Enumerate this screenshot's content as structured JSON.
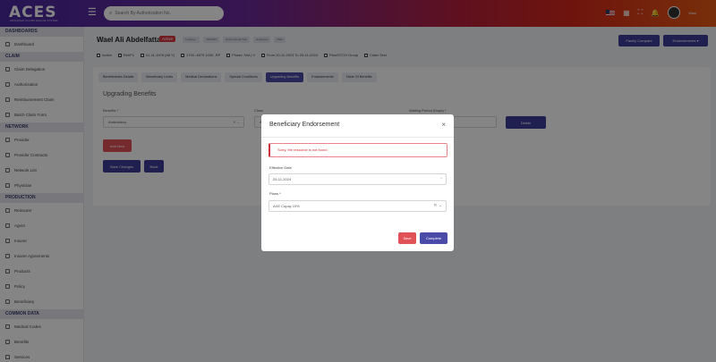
{
  "app": {
    "logo_text": "ACES",
    "logo_subtitle": "ADVANCED CLAIMS ENGINE SYSTEM"
  },
  "topbar": {
    "search_placeholder": "Search By Authorization No.",
    "user_label": "Waw"
  },
  "sidebar": {
    "sections": [
      {
        "title": "DASHBOARDS",
        "items": [
          {
            "label": "Dashboard",
            "icon": "grid-icon"
          }
        ]
      },
      {
        "title": "CLAIM",
        "items": [
          {
            "label": "Claim Delegation",
            "icon": "doc-icon"
          },
          {
            "label": "Authorization",
            "icon": "heart-icon"
          },
          {
            "label": "Reimbursement Claim",
            "icon": "receipt-icon"
          },
          {
            "label": "Batch Claim Form",
            "icon": "list-icon"
          }
        ]
      },
      {
        "title": "NETWORK",
        "items": [
          {
            "label": "Provider",
            "icon": "building-icon"
          },
          {
            "label": "Provider Contracts",
            "icon": "contract-icon"
          },
          {
            "label": "Network List",
            "icon": "network-icon"
          },
          {
            "label": "Physician",
            "icon": "user-md-icon"
          }
        ]
      },
      {
        "title": "PRODUCTION",
        "items": [
          {
            "label": "Reinsurer",
            "icon": "shield-icon"
          },
          {
            "label": "Agent",
            "icon": "user-icon"
          },
          {
            "label": "Insurer",
            "icon": "briefcase-icon"
          },
          {
            "label": "Insurer Agreements",
            "icon": "handshake-icon"
          },
          {
            "label": "Products",
            "icon": "box-icon"
          },
          {
            "label": "Policy",
            "icon": "policy-icon"
          },
          {
            "label": "Beneficiary",
            "icon": "people-icon"
          }
        ]
      },
      {
        "title": "COMMON DATA",
        "items": [
          {
            "label": "Medical Codes",
            "icon": "star-icon"
          },
          {
            "label": "Benefits",
            "icon": "gear-icon"
          },
          {
            "label": "Services",
            "icon": "service-icon"
          }
        ]
      }
    ]
  },
  "header": {
    "name": "Wael Ali Abdelfattah",
    "status": "Active",
    "tags": [
      "Loading...",
      "2150403",
      "Fixed Annual Plan",
      "Employee",
      "Male"
    ],
    "info": [
      "Active",
      "Rel/P1",
      "01-11-1976 (48 Y)",
      "1700 -4679 1030 -RP",
      "Phase: N/A | 0",
      "From 20-11-2023 To 25-11-2024",
      "Plan/STCH Group",
      "Claim Test"
    ],
    "btn_family": "Family Compare",
    "btn_endorsement": "Endorsements"
  },
  "card": {
    "tabs": [
      "Beneficiaries Details",
      "Beneficiary Limits",
      "Medical Declarations",
      "Special Conditions",
      "Upgrading Benefits",
      "Endorsements",
      "Table Of Benefits"
    ],
    "active_tab": "Upgrading Benefits",
    "title": "Upgrading Benefits",
    "benefit_label": "Benefits *",
    "benefit_value": "Ambulatory",
    "class_label": "Class",
    "class_value": "A",
    "waiting_label": "Waiting Period (Days) *",
    "btn_delete": "Delete",
    "btn_add_new": "Add New",
    "btn_save_changes": "Save Changes",
    "btn_back": "Back"
  },
  "modal": {
    "title": "Beneficiary Endorsement",
    "alert": "Sorry, the resource is not found",
    "effective_date_label": "Effective Date",
    "effective_date_value": "25-11-2024",
    "plans_label": "Plans *",
    "plans_value": "AXE Copay 10%",
    "btn_save": "Save",
    "btn_complete": "Complete"
  },
  "colors": {
    "primary": "#3e3f99",
    "danger": "#e05256",
    "header_gradient_start": "#4a2aa0",
    "header_gradient_end": "#e65a14"
  }
}
